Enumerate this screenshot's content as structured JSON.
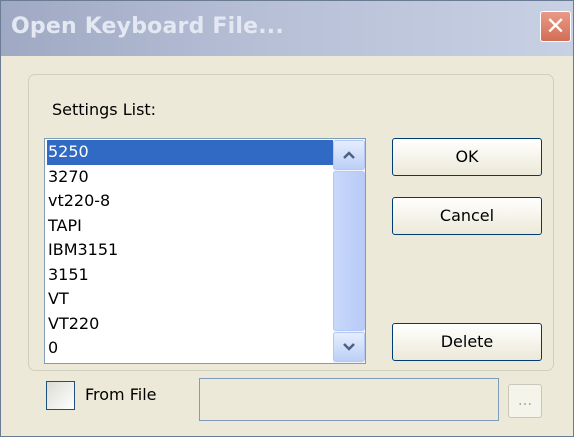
{
  "window": {
    "title": "Open Keyboard File...",
    "close_glyph": "✕"
  },
  "settings_list": {
    "label": "Settings List:",
    "items": [
      "5250",
      "3270",
      "vt220-8",
      "TAPI",
      "IBM3151",
      "3151",
      "VT",
      "VT220",
      "0"
    ],
    "selected_index": 0
  },
  "buttons": {
    "ok": "OK",
    "cancel": "Cancel",
    "delete": "Delete",
    "browse": "..."
  },
  "from_file": {
    "label": "From File",
    "checked": false,
    "path_value": ""
  },
  "colors": {
    "selection": "#316ac5",
    "dialog_background": "#ece9d8",
    "title_gradient_start": "#9fa9c3",
    "close_button": "#d36e56"
  },
  "icons": {
    "scroll_up": "chevron-up-icon",
    "scroll_down": "chevron-down-icon",
    "close": "close-icon"
  }
}
